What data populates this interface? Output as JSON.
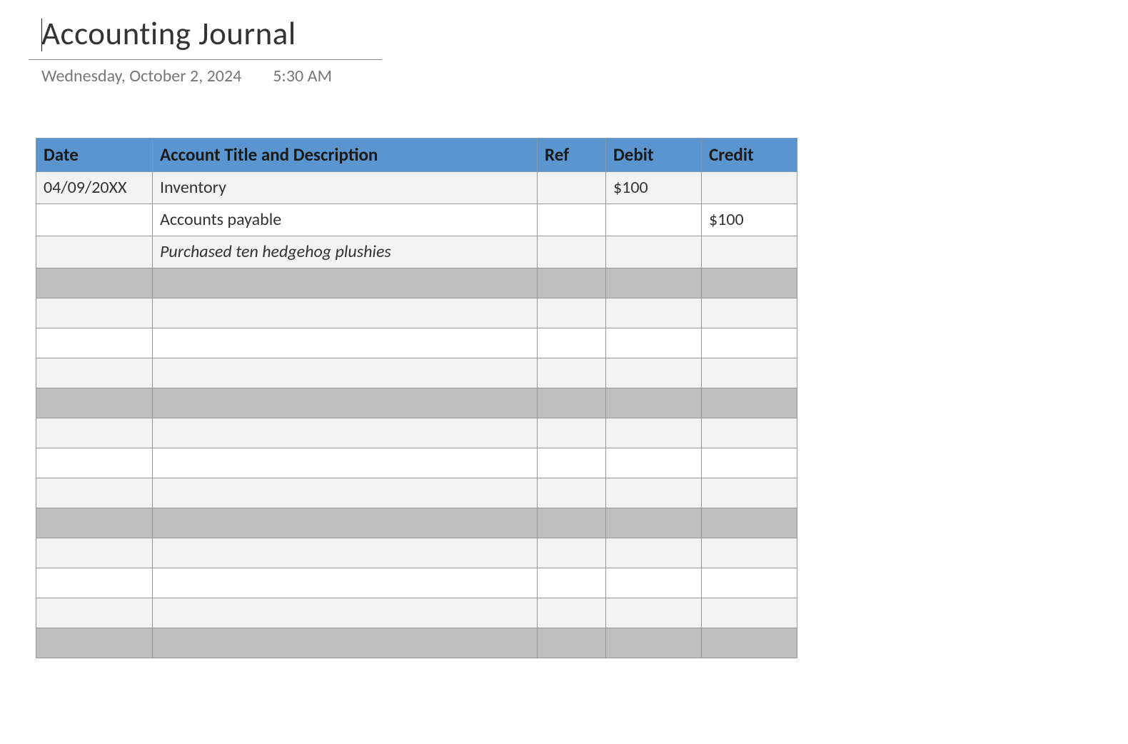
{
  "header": {
    "title": "Accounting Journal",
    "date": "Wednesday, October 2, 2024",
    "time": "5:30 AM"
  },
  "table": {
    "columns": [
      "Date",
      "Account Title and Description",
      "Ref",
      "Debit",
      "Credit"
    ],
    "rows": [
      {
        "shade": "light",
        "cells": [
          "04/09/20XX",
          "Inventory",
          "",
          "$100",
          ""
        ],
        "italicCol": null
      },
      {
        "shade": "white",
        "cells": [
          "",
          "Accounts payable",
          "",
          "",
          "$100"
        ],
        "italicCol": null
      },
      {
        "shade": "light",
        "cells": [
          "",
          "Purchased ten hedgehog plushies",
          "",
          "",
          ""
        ],
        "italicCol": 1
      },
      {
        "shade": "dark",
        "cells": [
          "",
          "",
          "",
          "",
          ""
        ],
        "italicCol": null
      },
      {
        "shade": "light",
        "cells": [
          "",
          "",
          "",
          "",
          ""
        ],
        "italicCol": null
      },
      {
        "shade": "white",
        "cells": [
          "",
          "",
          "",
          "",
          ""
        ],
        "italicCol": null
      },
      {
        "shade": "light",
        "cells": [
          "",
          "",
          "",
          "",
          ""
        ],
        "italicCol": null
      },
      {
        "shade": "dark",
        "cells": [
          "",
          "",
          "",
          "",
          ""
        ],
        "italicCol": null
      },
      {
        "shade": "light",
        "cells": [
          "",
          "",
          "",
          "",
          ""
        ],
        "italicCol": null
      },
      {
        "shade": "white",
        "cells": [
          "",
          "",
          "",
          "",
          ""
        ],
        "italicCol": null
      },
      {
        "shade": "light",
        "cells": [
          "",
          "",
          "",
          "",
          ""
        ],
        "italicCol": null
      },
      {
        "shade": "dark",
        "cells": [
          "",
          "",
          "",
          "",
          ""
        ],
        "italicCol": null
      },
      {
        "shade": "light",
        "cells": [
          "",
          "",
          "",
          "",
          ""
        ],
        "italicCol": null
      },
      {
        "shade": "white",
        "cells": [
          "",
          "",
          "",
          "",
          ""
        ],
        "italicCol": null
      },
      {
        "shade": "light",
        "cells": [
          "",
          "",
          "",
          "",
          ""
        ],
        "italicCol": null
      },
      {
        "shade": "dark",
        "cells": [
          "",
          "",
          "",
          "",
          ""
        ],
        "italicCol": null
      }
    ]
  }
}
